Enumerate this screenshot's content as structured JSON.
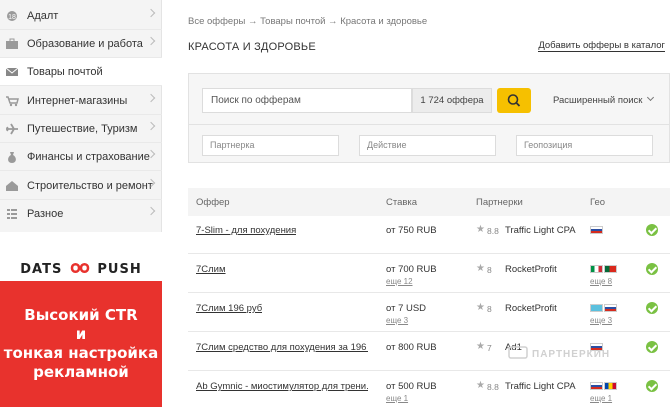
{
  "sidebar": {
    "items": [
      {
        "label": "Адалт",
        "icon": "adult-icon"
      },
      {
        "label": "Образование и работа",
        "icon": "briefcase-icon"
      },
      {
        "label": "Товары почтой",
        "icon": "mail-icon"
      },
      {
        "label": "Интернет-магазины",
        "icon": "cart-icon"
      },
      {
        "label": "Путешествие, Туризм",
        "icon": "plane-icon"
      },
      {
        "label": "Финансы и страхование",
        "icon": "money-bag-icon"
      },
      {
        "label": "Строительство и ремонт",
        "icon": "house-icon"
      },
      {
        "label": "Разное",
        "icon": "list-icon"
      }
    ],
    "active_index": 2
  },
  "banner": {
    "brand_left": "DATS",
    "brand_right": "PUSH",
    "line1": "Высокий CTR",
    "line2": "и",
    "line3": "тонкая настройка",
    "line4": "рекламной",
    "colors": {
      "red": "#e8322d"
    }
  },
  "breadcrumb": "Все офферы → Товары почтой → Красота и здоровье",
  "page_title": "КРАСОТА И ЗДОРОВЬЕ",
  "add_offers_link": "Добавить офферы в каталог",
  "search": {
    "placeholder": "Поиск по офферам",
    "count": "1 724 оффера",
    "advanced_label": "Расширенный поиск",
    "filters": {
      "partner_placeholder": "Партнерка",
      "action_placeholder": "Действие",
      "geo_placeholder": "Геопозиция"
    }
  },
  "table": {
    "headers": {
      "offer": "Оффер",
      "rate": "Ставка",
      "partners": "Партнерки",
      "geo": "Гео"
    },
    "rows": [
      {
        "offer": "7-Slim - для похудения",
        "rate": "от 750 RUB",
        "rate_more": "",
        "rating": "8.8",
        "partner": "Traffic Light CPA",
        "flags": [
          "ru"
        ],
        "geo_more": ""
      },
      {
        "offer": "7Слим",
        "rate": "от 700 RUB",
        "rate_more": "еще 12",
        "rating": "8",
        "partner": "RocketProfit",
        "flags": [
          "it",
          "pt"
        ],
        "geo_more": "еще 8"
      },
      {
        "offer": "7Слим 196 руб",
        "rate": "от 7 USD",
        "rate_more": "еще 3",
        "rating": "8",
        "partner": "RocketProfit",
        "flags": [
          "kz",
          "ru"
        ],
        "geo_more": "еще 3"
      },
      {
        "offer": "7Слим средство для похудения за 196 ...",
        "rate": "от 800 RUB",
        "rate_more": "",
        "rating": "7",
        "partner": "Ad1",
        "flags": [
          "ru"
        ],
        "geo_more": ""
      },
      {
        "offer": "Ab Gymnic - миостимулятор для трени...",
        "rate": "от 500 RUB",
        "rate_more": "еще 1",
        "rating": "8.8",
        "partner": "Traffic Light CPA",
        "flags": [
          "ru",
          "md"
        ],
        "geo_more": "еще 1"
      }
    ]
  },
  "watermark": "ПАРТНЕРКИН",
  "colors": {
    "accent": "#f6c000",
    "ok": "#7ac143"
  }
}
